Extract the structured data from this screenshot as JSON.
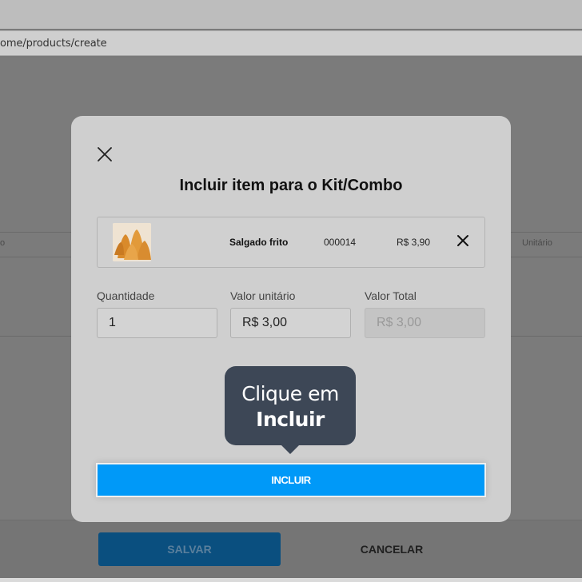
{
  "browser": {
    "url": "ome/products/create"
  },
  "background_page": {
    "table_header_left": "o",
    "table_header_right": "Unitário",
    "save_label": "SALVAR",
    "cancel_label": "CANCELAR"
  },
  "modal": {
    "title": "Incluir item para o Kit/Combo",
    "close_icon": "close-icon",
    "item": {
      "image_icon": "coxinha-image",
      "name": "Salgado frito",
      "code": "000014",
      "price": "R$ 3,90",
      "remove_icon": "close-icon"
    },
    "fields": [
      {
        "label": "Quantidade",
        "value": "1",
        "disabled": false
      },
      {
        "label": "Valor unitário",
        "value": "R$ 3,00",
        "disabled": false
      },
      {
        "label": "Valor Total",
        "value": "R$ 3,00",
        "disabled": true
      }
    ],
    "submit_label": "INCLUIR"
  },
  "tooltip": {
    "line1": "Clique em",
    "line2": "Incluir"
  },
  "colors": {
    "primary": "#0099f8",
    "tooltip": "#3d4756",
    "save_button": "#0a4f7f"
  }
}
